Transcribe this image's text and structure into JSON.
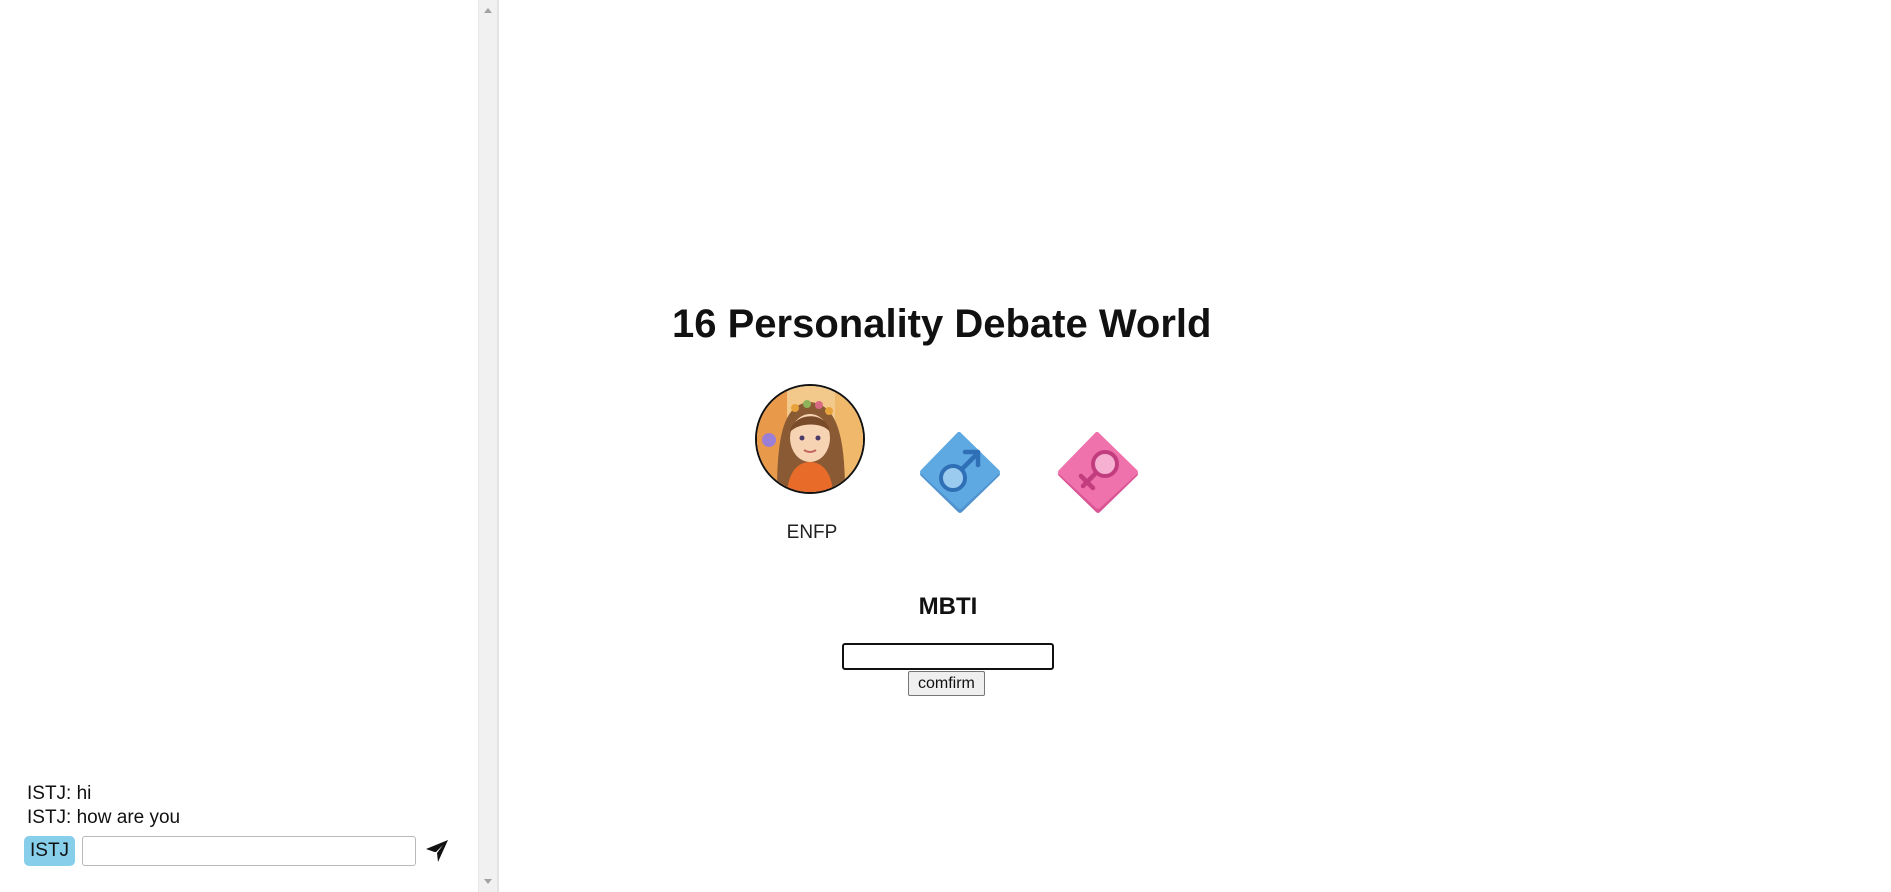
{
  "chat": {
    "messages": [
      {
        "sender": "ISTJ",
        "text": "ISTJ: hi"
      },
      {
        "sender": "ISTJ",
        "text": "ISTJ: how are you"
      }
    ],
    "user_tag": "ISTJ",
    "input_value": "",
    "send_icon": "paper-plane-icon"
  },
  "main": {
    "title": "16 Personality Debate World",
    "avatar": {
      "label": "ENFP"
    },
    "gender_options": [
      {
        "name": "male",
        "icon": "male-symbol-icon",
        "color": "#5aa6e0"
      },
      {
        "name": "female",
        "icon": "female-symbol-icon",
        "color": "#ec6aa6"
      }
    ],
    "mbti": {
      "heading": "MBTI",
      "input_value": "",
      "confirm_label": "comfirm"
    }
  },
  "colors": {
    "user_tag_bg": "#87ceeb",
    "male_diamond": "#5aa6e0",
    "female_diamond": "#ec6aa6"
  }
}
